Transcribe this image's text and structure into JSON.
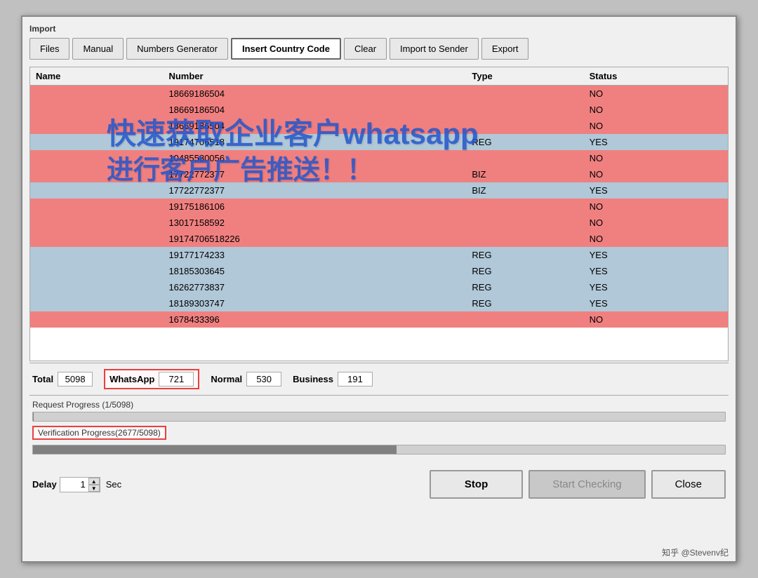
{
  "window": {
    "section_label": "Import"
  },
  "toolbar": {
    "buttons": [
      {
        "id": "files",
        "label": "Files",
        "active": false
      },
      {
        "id": "manual",
        "label": "Manual",
        "active": false
      },
      {
        "id": "numbers-generator",
        "label": "Numbers Generator",
        "active": false
      },
      {
        "id": "insert-country-code",
        "label": "Insert Country Code",
        "active": true
      },
      {
        "id": "clear",
        "label": "Clear",
        "active": false
      },
      {
        "id": "import-to-sender",
        "label": "Import to Sender",
        "active": false
      },
      {
        "id": "export",
        "label": "Export",
        "active": false
      }
    ]
  },
  "table": {
    "columns": [
      "Name",
      "Number",
      "Type",
      "Status"
    ],
    "rows": [
      {
        "name": "",
        "number": "18669186504",
        "type": "",
        "status": "NO",
        "rowType": "no"
      },
      {
        "name": "",
        "number": "18669186504",
        "type": "",
        "status": "NO",
        "rowType": "no"
      },
      {
        "name": "",
        "number": "18669186504",
        "type": "",
        "status": "NO",
        "rowType": "no"
      },
      {
        "name": "",
        "number": "19174706518",
        "type": "REG",
        "status": "YES",
        "rowType": "yes"
      },
      {
        "name": "",
        "number": "10485580056",
        "type": "",
        "status": "NO",
        "rowType": "no"
      },
      {
        "name": "",
        "number": "17722772377",
        "type": "BIZ",
        "status": "NO",
        "rowType": "no"
      },
      {
        "name": "",
        "number": "17722772377",
        "type": "BIZ",
        "status": "YES",
        "rowType": "yes"
      },
      {
        "name": "",
        "number": "19175186106",
        "type": "",
        "status": "NO",
        "rowType": "no"
      },
      {
        "name": "",
        "number": "13017158592",
        "type": "",
        "status": "NO",
        "rowType": "no"
      },
      {
        "name": "",
        "number": "19174706518226",
        "type": "",
        "status": "NO",
        "rowType": "no"
      },
      {
        "name": "",
        "number": "19177174233",
        "type": "REG",
        "status": "YES",
        "rowType": "yes"
      },
      {
        "name": "",
        "number": "18185303645",
        "type": "REG",
        "status": "YES",
        "rowType": "yes"
      },
      {
        "name": "",
        "number": "16262773837",
        "type": "REG",
        "status": "YES",
        "rowType": "yes"
      },
      {
        "name": "",
        "number": "18189303747",
        "type": "REG",
        "status": "YES",
        "rowType": "yes"
      },
      {
        "name": "",
        "number": "1678433396",
        "type": "",
        "status": "NO",
        "rowType": "no"
      }
    ]
  },
  "stats": {
    "total_label": "Total",
    "total_value": "5098",
    "whatsapp_label": "WhatsApp",
    "whatsapp_value": "721",
    "normal_label": "Normal",
    "normal_value": "530",
    "business_label": "Business",
    "business_value": "191"
  },
  "progress": {
    "request_label": "Request Progress (1/5098)",
    "request_percent": 0.02,
    "verification_label": "Verification Progress(2677/5098)",
    "verification_percent": 52.5
  },
  "delay": {
    "label": "Delay",
    "value": "1",
    "unit": "Sec"
  },
  "buttons": {
    "stop_label": "Stop",
    "start_checking_label": "Start Checking",
    "close_label": "Close"
  },
  "watermark": {
    "line1": "快速获取企业客户whatsapp",
    "line2": "进行客户广告推送！！"
  }
}
